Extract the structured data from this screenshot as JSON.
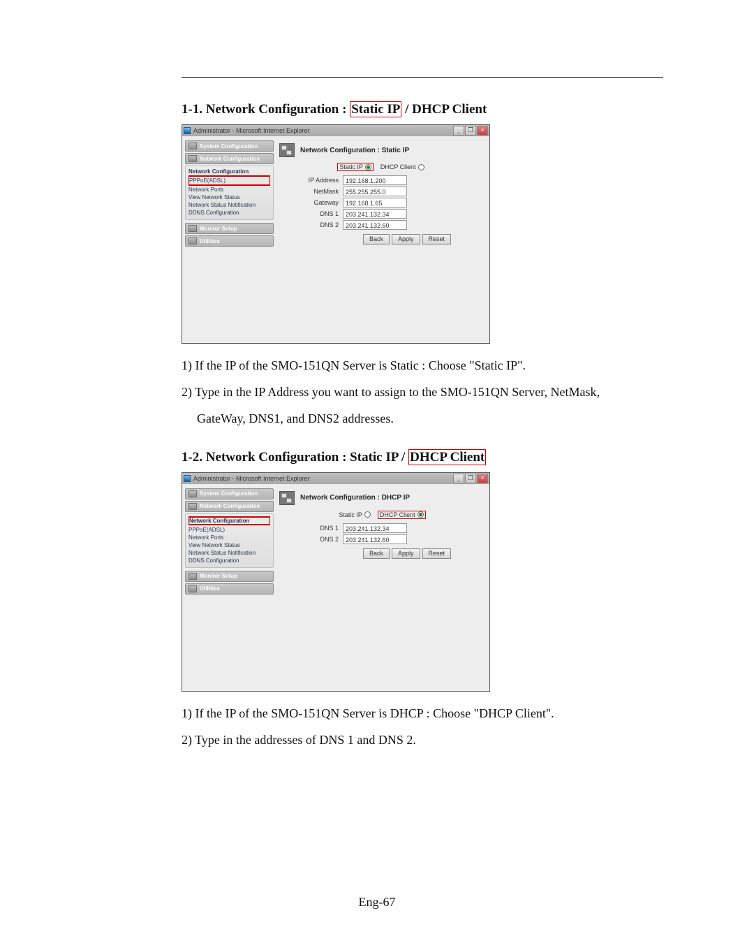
{
  "page_number": "Eng-67",
  "section_1": {
    "heading_prefix": "1-1. Network Configuration : ",
    "heading_boxed": "Static IP",
    "heading_suffix": " / DHCP Client",
    "body": [
      "1) If the IP of the SMO-151QN Server is Static : Choose \"Static IP\".",
      "2) Type in the IP Address you want to assign to the SMO-151QN Server, NetMask,",
      "GateWay, DNS1, and DNS2 addresses."
    ]
  },
  "section_2": {
    "heading_prefix": "1-2. Network Configuration : Static IP / ",
    "heading_boxed": "DHCP Client",
    "body": [
      "1) If the IP of the SMO-151QN Server is DHCP : Choose \"DHCP Client\".",
      "2) Type in the addresses of DNS 1 and DNS 2."
    ]
  },
  "ie_window_title": "Administrator - Microsoft Internet Explorer",
  "window_buttons": {
    "min": "_",
    "max": "❐",
    "close": "×"
  },
  "sidebar": {
    "system_configuration": "System Configuration",
    "network_configuration": "Network Configuration",
    "monitor_setup": "Monitor Setup",
    "utilities": "Utilities",
    "section_head": "Network Configuration",
    "items": {
      "pppoe": "PPPoE(ADSL)",
      "ports": "Network Ports",
      "view_status": "View Network Status",
      "status_notif": "Network Status Notification",
      "ddns": "DDNS Configuration"
    }
  },
  "screenshot_1": {
    "header": "Network Configuration : Static IP",
    "radio_static": "Static IP",
    "radio_dhcp": "DHCP Client",
    "fields": {
      "ip_label": "IP Address",
      "ip_value": "192.168.1.200",
      "netmask_label": "NetMask",
      "netmask_value": "255.255.255.0",
      "gateway_label": "Gateway",
      "gateway_value": "192.168.1.65",
      "dns1_label": "DNS 1",
      "dns1_value": "203.241.132.34",
      "dns2_label": "DNS 2",
      "dns2_value": "203.241.132.60"
    },
    "buttons": {
      "back": "Back",
      "apply": "Apply",
      "reset": "Reset"
    }
  },
  "screenshot_2": {
    "header": "Network Configuration : DHCP IP",
    "radio_static": "Static IP",
    "radio_dhcp": "DHCP Client",
    "fields": {
      "dns1_label": "DNS 1",
      "dns1_value": "203.241.132.34",
      "dns2_label": "DNS 2",
      "dns2_value": "203.241.132.60"
    },
    "buttons": {
      "back": "Back",
      "apply": "Apply",
      "reset": "Reset"
    }
  }
}
